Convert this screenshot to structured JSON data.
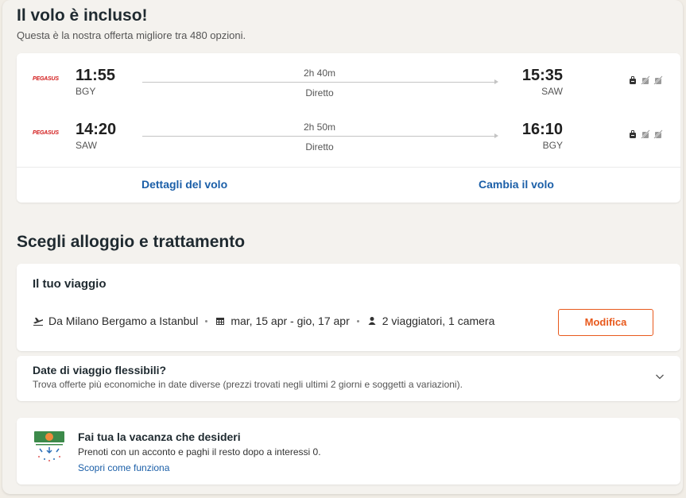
{
  "hero": {
    "title": "Il volo è incluso!",
    "subtitle": "Questa è la nostra offerta migliore tra 480 opzioni."
  },
  "flights": {
    "legs": [
      {
        "airline": "PEGASUS",
        "dep_time": "11:55",
        "dep_code": "BGY",
        "duration": "2h 40m",
        "stops": "Diretto",
        "arr_time": "15:35",
        "arr_code": "SAW"
      },
      {
        "airline": "PEGASUS",
        "dep_time": "14:20",
        "dep_code": "SAW",
        "duration": "2h 50m",
        "stops": "Diretto",
        "arr_time": "16:10",
        "arr_code": "BGY"
      }
    ],
    "details_label": "Dettagli del volo",
    "change_label": "Cambia il volo"
  },
  "stay": {
    "title": "Scegli alloggio e trattamento"
  },
  "trip": {
    "title": "Il tuo viaggio",
    "route": "Da Milano Bergamo a Istanbul",
    "dates": "mar, 15 apr - gio, 17 apr",
    "travelers": "2 viaggiatori, 1 camera",
    "modify_label": "Modifica"
  },
  "flex": {
    "title": "Date di viaggio flessibili?",
    "subtitle": "Trova offerte più economiche in date diverse (prezzi trovati negli ultimi 2 giorni e soggetti a variazioni)."
  },
  "promo": {
    "title": "Fai tua la vacanza che desideri",
    "subtitle": "Prenoti con un acconto e paghi il resto dopo a interessi 0.",
    "link": "Scopri come funziona"
  },
  "colors": {
    "accent": "#e8591c",
    "link": "#1b5fa8",
    "airline": "#d21b1b"
  },
  "icons": [
    "plane-icon",
    "calendar-icon",
    "person-icon",
    "chevron-down-icon",
    "bag-icon",
    "no-bag-icon"
  ]
}
